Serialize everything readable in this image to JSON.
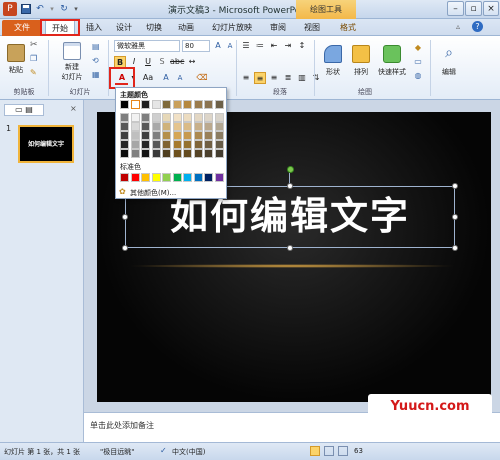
{
  "window": {
    "title": "演示文稿3 - Microsoft PowerPoint",
    "context_tab": "绘图工具"
  },
  "tabs": [
    "文件",
    "开始",
    "插入",
    "设计",
    "切换",
    "动画",
    "幻灯片放映",
    "审阅",
    "视图",
    "格式"
  ],
  "ribbon": {
    "clipboard": {
      "paste": "粘贴",
      "label": "剪贴板"
    },
    "slides": {
      "new_slide": "新建",
      "new_slide2": "幻灯片",
      "label": "幻灯片"
    },
    "font": {
      "font_name": "微软雅黑",
      "font_size": "80",
      "label": "字体"
    },
    "paragraph": {
      "label": "段落"
    },
    "drawing": {
      "shape": "形状",
      "arrange": "排列",
      "quick_styles": "快速样式",
      "label": "绘图"
    },
    "editing": {
      "edit": "编辑"
    }
  },
  "color_popup": {
    "theme_colors_label": "主题颜色",
    "standard_colors_label": "标准色",
    "more_colors": "其他颜色(M)...",
    "theme_top_row": [
      "#000000",
      "#ffffff",
      "#1f1f1f",
      "#e6e6e6",
      "#7f6a3b",
      "#c9a05c",
      "#b5883f",
      "#9a7b4c",
      "#8b7350",
      "#6d6048"
    ],
    "theme_columns": [
      [
        "#7f7f7f",
        "#595959",
        "#404040",
        "#262626",
        "#0d0d0d"
      ],
      [
        "#f2f2f2",
        "#d9d9d9",
        "#bfbfbf",
        "#a6a6a6",
        "#808080"
      ],
      [
        "#7f7f7f",
        "#595959",
        "#3f3f3f",
        "#262626",
        "#141414"
      ],
      [
        "#cfcfcf",
        "#a9a9a9",
        "#7f7f7f",
        "#595959",
        "#3a3a3a"
      ],
      [
        "#e6d8b8",
        "#cfb27a",
        "#b48f4b",
        "#7f6332",
        "#4f3e1f"
      ],
      [
        "#f1e1c6",
        "#e4c48e",
        "#d5a656",
        "#a67a2e",
        "#6e511e"
      ],
      [
        "#ecdcc0",
        "#dabb86",
        "#c7994e",
        "#95712f",
        "#634a1f"
      ],
      [
        "#e3d7c3",
        "#c8b08a",
        "#ac8950",
        "#80653a",
        "#554326"
      ],
      [
        "#ddd5c8",
        "#bba98e",
        "#998059",
        "#715f42",
        "#4b3f2c"
      ],
      [
        "#d8d3ca",
        "#b2a793",
        "#8b7c62",
        "#675c48",
        "#443d30"
      ]
    ],
    "standard": [
      "#c00000",
      "#ff0000",
      "#ffc000",
      "#ffff00",
      "#92d050",
      "#00b050",
      "#00b0f0",
      "#0070c0",
      "#002060",
      "#7030a0"
    ]
  },
  "slide_panel": {
    "slide_number": "1",
    "thumb_text": "如何编辑文字"
  },
  "slide": {
    "text": "如何编辑文字"
  },
  "notes": {
    "placeholder": "单击此处添加备注"
  },
  "status": {
    "slide_info": "幻灯片 第 1 张，共 1 张",
    "theme": "\"极目远眺\"",
    "language": "中文(中国)",
    "zoom": "63"
  },
  "watermark": {
    "text": "Yuucn.com"
  },
  "colors": {
    "accent_red": "#e1251b",
    "file_tab": "#d9601c",
    "drawing_ctx": "#f3b84a"
  }
}
